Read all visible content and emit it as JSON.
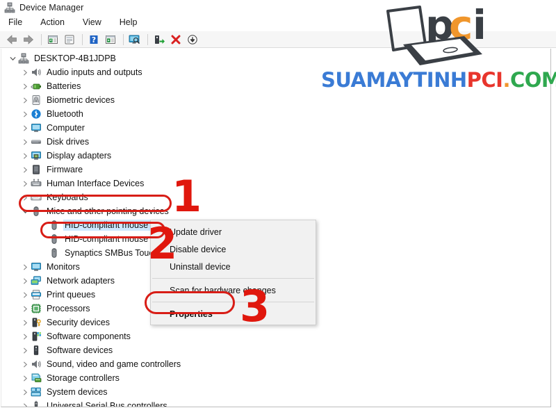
{
  "window": {
    "title": "Device Manager",
    "title_icon": "device-manager-icon"
  },
  "menubar": {
    "items": [
      {
        "label": "File"
      },
      {
        "label": "Action"
      },
      {
        "label": "View"
      },
      {
        "label": "Help"
      }
    ]
  },
  "toolbar": {
    "buttons": [
      {
        "name": "back-arrow-icon",
        "tooltip": "Back"
      },
      {
        "name": "forward-arrow-icon",
        "tooltip": "Forward"
      },
      {
        "name": "show-hide-console-tree-icon",
        "tooltip": "Show/Hide Console Tree"
      },
      {
        "name": "properties-icon",
        "tooltip": "Properties"
      },
      {
        "name": "help-icon",
        "tooltip": "Help"
      },
      {
        "name": "update-driver-icon",
        "tooltip": "Update Driver Software"
      },
      {
        "name": "scan-hardware-changes-icon",
        "tooltip": "Scan for hardware changes"
      },
      {
        "name": "enable-device-icon",
        "tooltip": "Enable device"
      },
      {
        "name": "uninstall-device-icon",
        "tooltip": "Uninstall device"
      },
      {
        "name": "disable-device-icon",
        "tooltip": "Disable device"
      }
    ]
  },
  "tree": {
    "root": {
      "label": "DESKTOP-4B1JDPB",
      "icon": "computer-root-icon",
      "expanded": true
    },
    "items": [
      {
        "label": "Audio inputs and outputs",
        "icon": "speaker-icon",
        "level": 1,
        "expanded": false,
        "selected": false
      },
      {
        "label": "Batteries",
        "icon": "battery-icon",
        "level": 1,
        "expanded": false,
        "selected": false
      },
      {
        "label": "Biometric devices",
        "icon": "fingerprint-icon",
        "level": 1,
        "expanded": false,
        "selected": false
      },
      {
        "label": "Bluetooth",
        "icon": "bluetooth-icon",
        "level": 1,
        "expanded": false,
        "selected": false
      },
      {
        "label": "Computer",
        "icon": "monitor-icon",
        "level": 1,
        "expanded": false,
        "selected": false
      },
      {
        "label": "Disk drives",
        "icon": "disk-drive-icon",
        "level": 1,
        "expanded": false,
        "selected": false
      },
      {
        "label": "Display adapters",
        "icon": "display-adapter-icon",
        "level": 1,
        "expanded": false,
        "selected": false
      },
      {
        "label": "Firmware",
        "icon": "firmware-icon",
        "level": 1,
        "expanded": false,
        "selected": false
      },
      {
        "label": "Human Interface Devices",
        "icon": "hid-icon",
        "level": 1,
        "expanded": false,
        "selected": false
      },
      {
        "label": "Keyboards",
        "icon": "keyboard-icon",
        "level": 1,
        "expanded": false,
        "selected": false
      },
      {
        "label": "Mice and other pointing devices",
        "icon": "mouse-icon",
        "level": 1,
        "expanded": true,
        "selected": false
      },
      {
        "label": "HID-compliant mouse",
        "icon": "mouse-icon",
        "level": 2,
        "expanded": null,
        "selected": true
      },
      {
        "label": "HID-compliant mouse",
        "icon": "mouse-icon",
        "level": 2,
        "expanded": null,
        "selected": false
      },
      {
        "label": "Synaptics SMBus Touc",
        "icon": "mouse-icon",
        "level": 2,
        "expanded": null,
        "selected": false
      },
      {
        "label": "Monitors",
        "icon": "monitor-icon",
        "level": 1,
        "expanded": false,
        "selected": false
      },
      {
        "label": "Network adapters",
        "icon": "network-adapter-icon",
        "level": 1,
        "expanded": false,
        "selected": false
      },
      {
        "label": "Print queues",
        "icon": "printer-icon",
        "level": 1,
        "expanded": false,
        "selected": false
      },
      {
        "label": "Processors",
        "icon": "processor-icon",
        "level": 1,
        "expanded": false,
        "selected": false
      },
      {
        "label": "Security devices",
        "icon": "security-device-icon",
        "level": 1,
        "expanded": false,
        "selected": false
      },
      {
        "label": "Software components",
        "icon": "software-component-icon",
        "level": 1,
        "expanded": false,
        "selected": false
      },
      {
        "label": "Software devices",
        "icon": "software-device-icon",
        "level": 1,
        "expanded": false,
        "selected": false
      },
      {
        "label": "Sound, video and game controllers",
        "icon": "speaker-icon",
        "level": 1,
        "expanded": false,
        "selected": false
      },
      {
        "label": "Storage controllers",
        "icon": "storage-controller-icon",
        "level": 1,
        "expanded": false,
        "selected": false
      },
      {
        "label": "System devices",
        "icon": "system-device-icon",
        "level": 1,
        "expanded": false,
        "selected": false
      },
      {
        "label": "Universal Serial Bus controllers",
        "icon": "usb-icon",
        "level": 1,
        "expanded": false,
        "selected": false
      }
    ]
  },
  "context_menu": {
    "items": [
      {
        "label": "Update driver",
        "bold": false,
        "separator_after": false
      },
      {
        "label": "Disable device",
        "bold": false,
        "separator_after": false
      },
      {
        "label": "Uninstall device",
        "bold": false,
        "separator_after": true
      },
      {
        "label": "Scan for hardware changes",
        "bold": false,
        "separator_after": true
      },
      {
        "label": "Properties",
        "bold": true,
        "separator_after": false
      }
    ]
  },
  "annotations": {
    "color": "#d81d16",
    "steps": [
      {
        "number": "1",
        "target": "Mice and other pointing devices"
      },
      {
        "number": "2",
        "target": "HID-compliant mouse"
      },
      {
        "number": "3",
        "target": "Properties"
      }
    ]
  },
  "watermark": {
    "logo_text": "pci",
    "site_parts": [
      {
        "text": "SUAMAYTINH",
        "color": "#3a7bd5"
      },
      {
        "text": "PCI",
        "color": "#e8352c"
      },
      {
        "text": ".",
        "color": "#f0962c"
      },
      {
        "text": "COM",
        "color": "#2fa84f"
      }
    ],
    "full_text": "SUAMAYTINHPCI.COM"
  }
}
